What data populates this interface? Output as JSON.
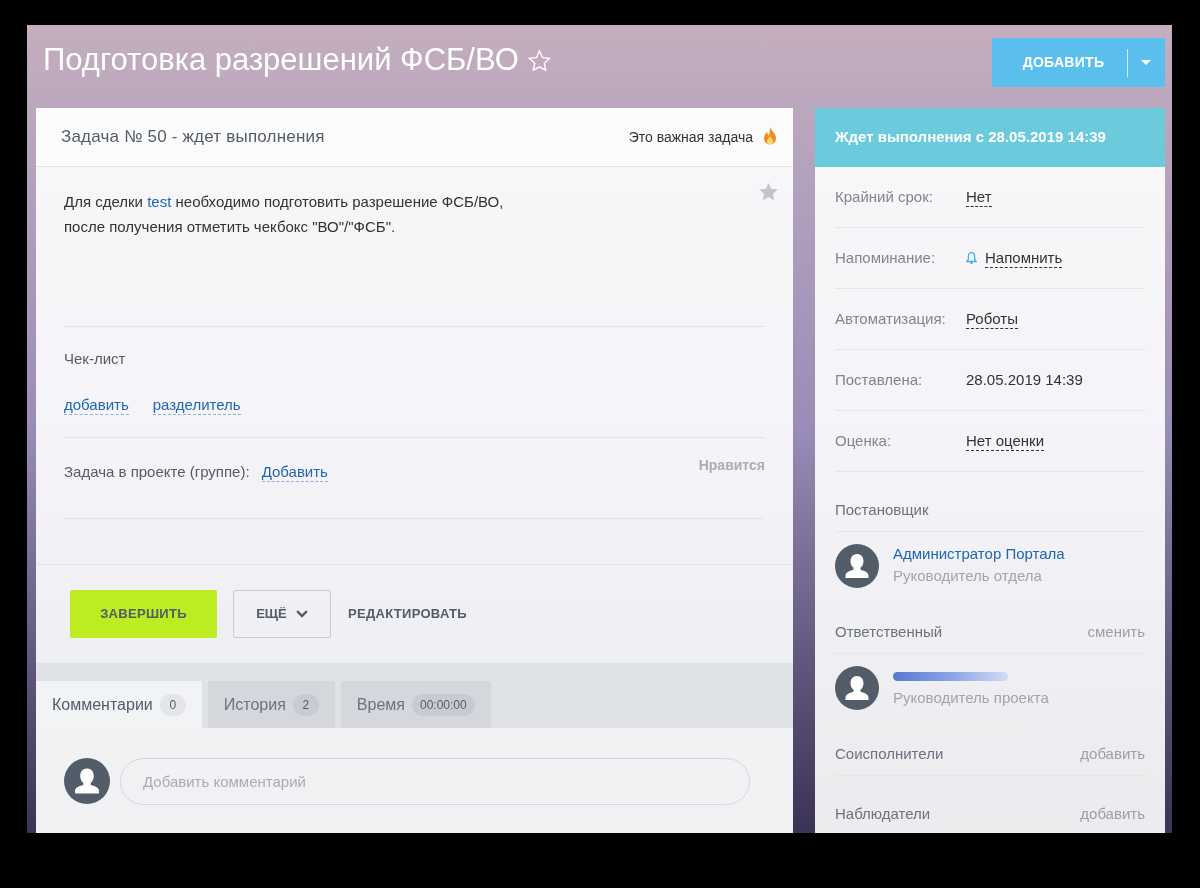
{
  "header": {
    "title": "Подготовка разрешений ФСБ/ВО",
    "favorite": false,
    "add_button": "ДОБАВИТЬ"
  },
  "task": {
    "title": "Задача № 50 - ждет выполнения",
    "important_label": "Это важная задача",
    "description": {
      "before": "Для сделки ",
      "link": "test",
      "after": " необходимо подготовить разрешение ФСБ/ВО,\nпосле получения отметить чекбокс \"ВО\"/\"ФСБ\"."
    },
    "checklist": {
      "title": "Чек-лист",
      "links": [
        "добавить",
        "разделитель"
      ]
    },
    "project": {
      "label": "Задача в проекте (группе):",
      "link": "Добавить"
    },
    "like_label": "Нравится",
    "actions": [
      {
        "kind": "primary",
        "label": "ЗАВЕРШИТЬ"
      },
      {
        "kind": "menu",
        "label": "ЕЩЁ"
      },
      {
        "kind": "link",
        "label": "РЕДАКТИРОВАТЬ"
      }
    ],
    "tabs": [
      {
        "label": "Комментарии",
        "count": "0",
        "selected": true
      },
      {
        "label": "История",
        "count": "2",
        "selected": false
      },
      {
        "label": "Время",
        "count": "00:00:00",
        "selected": false
      }
    ],
    "comment_field": {
      "placeholder": "Добавить комментарий"
    }
  },
  "sidebar": {
    "status": "Ждет выполнения с 28.05.2019 14:39",
    "fields": [
      {
        "kind": "link",
        "label": "Крайний срок:",
        "value": "Нет"
      },
      {
        "kind": "reminder",
        "label": "Напоминание:",
        "value": "Напомнить"
      },
      {
        "kind": "link",
        "label": "Автоматизация:",
        "value": "Роботы"
      },
      {
        "kind": "text",
        "label": "Поставлена:",
        "value": "28.05.2019 14:39"
      },
      {
        "kind": "link",
        "label": "Оценка:",
        "value": "Нет оценки"
      }
    ],
    "roles": [
      {
        "title": "Постановщик",
        "people": [
          {
            "name": "Администратор Портала",
            "name_blurred": false,
            "position": "Руководитель отдела"
          }
        ]
      },
      {
        "title": "Ответственный",
        "action": "сменить",
        "people": [
          {
            "name_blurred": true,
            "position": "Руководитель проекта"
          }
        ]
      },
      {
        "title": "Соисполнители",
        "action": "добавить"
      },
      {
        "title": "Наблюдатели",
        "action": "добавить"
      }
    ]
  }
}
